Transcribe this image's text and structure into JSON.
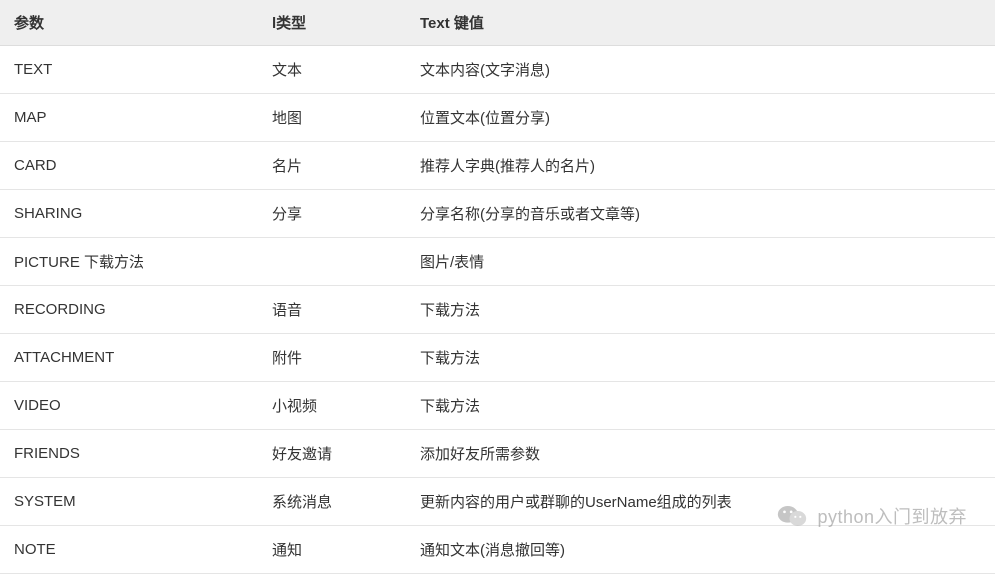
{
  "table": {
    "headers": {
      "param": "参数",
      "type": "l类型",
      "text": "Text 键值"
    },
    "rows": [
      {
        "param": "TEXT",
        "type": "文本",
        "text": "文本内容(文字消息)"
      },
      {
        "param": "MAP",
        "type": "地图",
        "text": "位置文本(位置分享)"
      },
      {
        "param": "CARD",
        "type": "名片",
        "text": "推荐人字典(推荐人的名片)"
      },
      {
        "param": "SHARING",
        "type": "分享",
        "text": "分享名称(分享的音乐或者文章等)"
      },
      {
        "param": "PICTURE 下载方法",
        "type": "",
        "text": "图片/表情"
      },
      {
        "param": "RECORDING",
        "type": "语音",
        "text": "下载方法"
      },
      {
        "param": "ATTACHMENT",
        "type": "附件",
        "text": "下载方法"
      },
      {
        "param": "VIDEO",
        "type": "小视频",
        "text": "下载方法"
      },
      {
        "param": "FRIENDS",
        "type": "好友邀请",
        "text": "添加好友所需参数"
      },
      {
        "param": "SYSTEM",
        "type": "系统消息",
        "text": "更新内容的用户或群聊的UserName组成的列表"
      },
      {
        "param": "NOTE",
        "type": "通知",
        "text": "通知文本(消息撤回等)"
      }
    ]
  },
  "watermark": {
    "icon_name": "wechat-icon",
    "text": "python入门到放弃"
  }
}
